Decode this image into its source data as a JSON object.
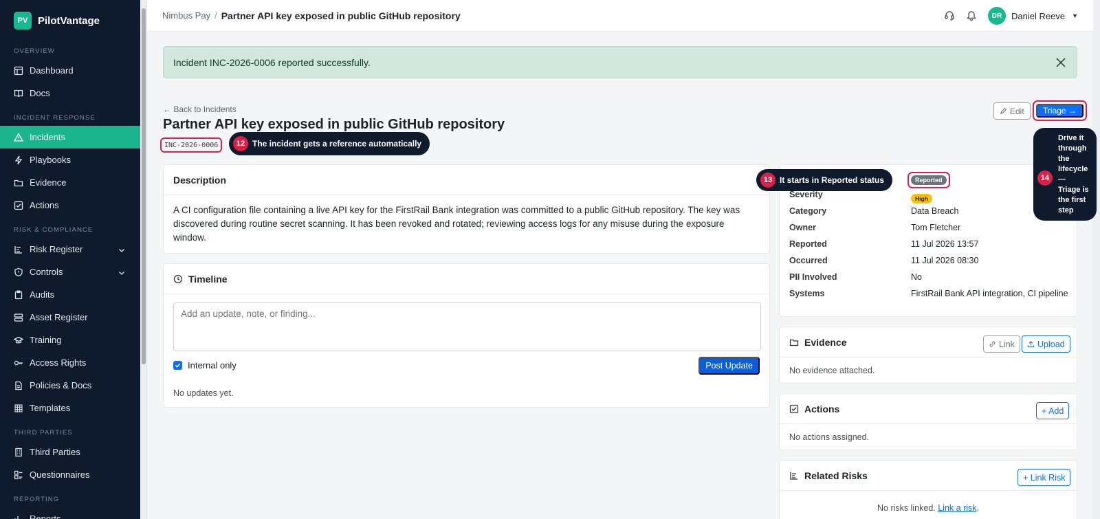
{
  "brand": {
    "logo": "PV",
    "name": "PilotVantage"
  },
  "sidebar": {
    "sections": [
      {
        "title": "OVERVIEW",
        "items": [
          {
            "label": "Dashboard",
            "icon": "dashboard-icon"
          },
          {
            "label": "Docs",
            "icon": "book-icon"
          }
        ]
      },
      {
        "title": "INCIDENT RESPONSE",
        "items": [
          {
            "label": "Incidents",
            "icon": "warning-icon",
            "active": true
          },
          {
            "label": "Playbooks",
            "icon": "lightning-icon"
          },
          {
            "label": "Evidence",
            "icon": "folder-icon"
          },
          {
            "label": "Actions",
            "icon": "checkbox-icon"
          }
        ]
      },
      {
        "title": "RISK & COMPLIANCE",
        "items": [
          {
            "label": "Risk Register",
            "icon": "list-icon",
            "chevron": true
          },
          {
            "label": "Controls",
            "icon": "shield-icon",
            "chevron": true
          },
          {
            "label": "Audits",
            "icon": "clipboard-icon"
          },
          {
            "label": "Asset Register",
            "icon": "server-icon"
          },
          {
            "label": "Training",
            "icon": "graduation-icon"
          },
          {
            "label": "Access Rights",
            "icon": "key-icon"
          },
          {
            "label": "Policies & Docs",
            "icon": "document-icon"
          },
          {
            "label": "Templates",
            "icon": "grid-icon"
          }
        ]
      },
      {
        "title": "THIRD PARTIES",
        "items": [
          {
            "label": "Third Parties",
            "icon": "building-icon"
          },
          {
            "label": "Questionnaires",
            "icon": "form-icon"
          }
        ]
      },
      {
        "title": "REPORTING",
        "items": [
          {
            "label": "Reports",
            "icon": "chart-icon"
          }
        ]
      }
    ]
  },
  "topbar": {
    "crumb_root": "Nimbus Pay",
    "crumb_sep": "/",
    "crumb_current": "Partner API key exposed in public GitHub repository",
    "user_initials": "DR",
    "user_name": "Daniel Reeve"
  },
  "alert": {
    "message": "Incident INC-2026-0006 reported successfully."
  },
  "incident": {
    "back_link": "← Back to Incidents",
    "title": "Partner API key exposed in public GitHub repository",
    "reference": "INC-2026-0006",
    "edit_label": "Edit",
    "triage_label": "Triage →",
    "description_title": "Description",
    "description": "A CI configuration file containing a live API key for the FirstRail Bank integration was committed to a public GitHub repository. The key was discovered during routine secret scanning. It has been revoked and rotated; reviewing access logs for any misuse during the exposure window.",
    "timeline_title": "Timeline",
    "timeline_placeholder": "Add an update, note, or finding...",
    "internal_only_label": "Internal only",
    "post_update_label": "Post Update",
    "no_updates": "No updates yet."
  },
  "details": {
    "status": "Reported",
    "rows": [
      {
        "label": "Severity",
        "value": "High"
      },
      {
        "label": "Category",
        "value": "Data Breach"
      },
      {
        "label": "Owner",
        "value": "Tom Fletcher"
      },
      {
        "label": "Reported",
        "value": "11 Jul 2026 13:57"
      },
      {
        "label": "Occurred",
        "value": "11 Jul 2026 08:30"
      },
      {
        "label": "PII Involved",
        "value": "No"
      },
      {
        "label": "Systems",
        "value": "FirstRail Bank API integration, CI pipeline"
      }
    ]
  },
  "evidence": {
    "title": "Evidence",
    "link_label": "Link",
    "upload_label": "Upload",
    "empty": "No evidence attached."
  },
  "actions": {
    "title": "Actions",
    "add_label": "+ Add",
    "empty": "No actions assigned."
  },
  "risks": {
    "title": "Related Risks",
    "link_label": "+ Link Risk",
    "empty": "No risks linked.",
    "empty_link": "Link a risk",
    "empty_suffix": "."
  },
  "callouts": {
    "c12": {
      "num": "12",
      "pre": "The incident gets a ",
      "bold": "reference",
      "post": " automatically"
    },
    "c13": {
      "num": "13",
      "pre": "It starts in ",
      "bold": "Reported",
      "post": " status"
    },
    "c14": {
      "num": "14",
      "line1": "Drive it",
      "line2": "through",
      "line3": "the",
      "bold": "lifecycle",
      "line5": "—",
      "line6": "Triage is",
      "line7": "the first",
      "line8": "step"
    }
  },
  "colors": {
    "accent": "#1ab48d",
    "primary": "#0d6efd",
    "callout_red": "#d9214a",
    "sidebar_bg": "#0f1b2d"
  }
}
